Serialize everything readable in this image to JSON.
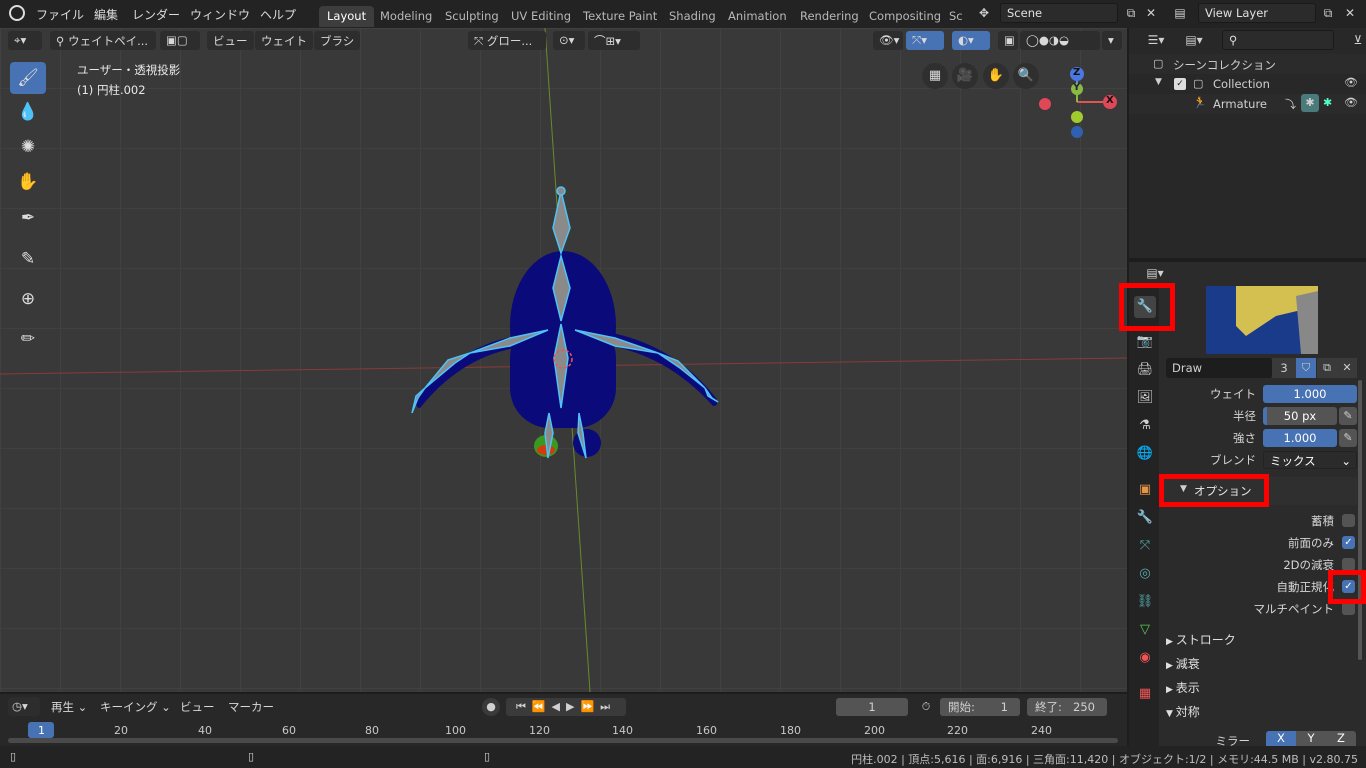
{
  "menu": {
    "file": "ファイル",
    "edit": "編集",
    "render": "レンダー",
    "window": "ウィンドウ",
    "help": "ヘルプ"
  },
  "workspaces": [
    "Layout",
    "Modeling",
    "Sculpting",
    "UV Editing",
    "Texture Paint",
    "Shading",
    "Animation",
    "Rendering",
    "Compositing",
    "Sc"
  ],
  "scene": {
    "name": "Scene",
    "view_layer": "View Layer"
  },
  "viewport": {
    "mode": "ウェイトペイ...",
    "view": "ビュー",
    "weight": "ウェイト",
    "brush": "ブラシ",
    "orientation": "グロー...",
    "overlay_title": "ユーザー・透視投影",
    "overlay_object": "(1) 円柱.002",
    "gizmo": {
      "z": "Z",
      "y": "Y",
      "x": "X"
    }
  },
  "outliner": {
    "scene_collection": "シーンコレクション",
    "collection": "Collection",
    "armature": "Armature"
  },
  "properties": {
    "brush_name": "Draw",
    "brush_users": "3",
    "weight_label": "ウェイト",
    "weight_value": "1.000",
    "radius_label": "半径",
    "radius_value": "50 px",
    "strength_label": "強さ",
    "strength_value": "1.000",
    "blend_label": "ブレンド",
    "blend_value": "ミックス",
    "options_header": "オプション",
    "accumulate": "蓄積",
    "front_faces_only": "前面のみ",
    "falloff_2d": "2Dの減衰",
    "auto_normalize": "自動正規化",
    "multipaint": "マルチペイント",
    "stroke": "ストローク",
    "falloff": "減衰",
    "display": "表示",
    "symmetry": "対称",
    "mirror": "ミラー",
    "axis_x": "X",
    "axis_y": "Y",
    "axis_z": "Z"
  },
  "timeline": {
    "playback": "再生",
    "keying": "キーイング",
    "view": "ビュー",
    "marker": "マーカー",
    "current_frame": "1",
    "start_label": "開始:",
    "start": "1",
    "end_label": "終了:",
    "end": "250",
    "ticks": [
      "1",
      "20",
      "40",
      "60",
      "80",
      "100",
      "120",
      "140",
      "160",
      "180",
      "200",
      "220",
      "240"
    ]
  },
  "status": "円柱.002 | 頂点:5,616 | 面:6,916 | 三角面:11,420 | オブジェクト:1/2 | メモリ:44.5 MB | v2.80.75",
  "colors": {
    "accent": "#4772b3",
    "highlight": "#ff0000",
    "mesh": "#0a0a7a",
    "bone_outline": "#4fc3f7"
  }
}
